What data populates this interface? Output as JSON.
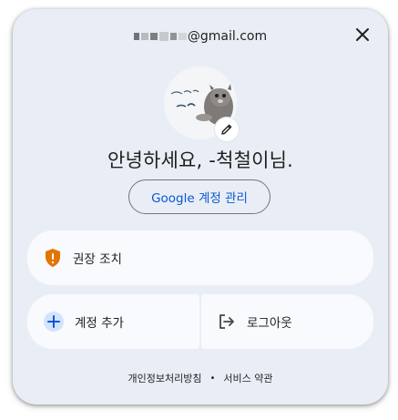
{
  "account": {
    "email_suffix": "@gmail.com",
    "greeting": "안녕하세요, -척철이님."
  },
  "buttons": {
    "manage_account": "Google 계정 관리",
    "recommended_action": "권장 조치",
    "add_account": "계정 추가",
    "sign_out": "로그아웃"
  },
  "footer": {
    "privacy": "개인정보처리방침",
    "separator": "•",
    "terms": "서비스 약관"
  },
  "icons": {
    "close": "close-icon",
    "edit": "pencil-icon",
    "warning": "shield-warning-icon",
    "add": "plus-icon",
    "logout": "logout-icon"
  },
  "colors": {
    "panel_bg": "#e9eef6",
    "card_bg": "#f8fafd",
    "link_blue": "#0b57d0",
    "warning_orange": "#e37400",
    "icon_dark": "#444746"
  }
}
